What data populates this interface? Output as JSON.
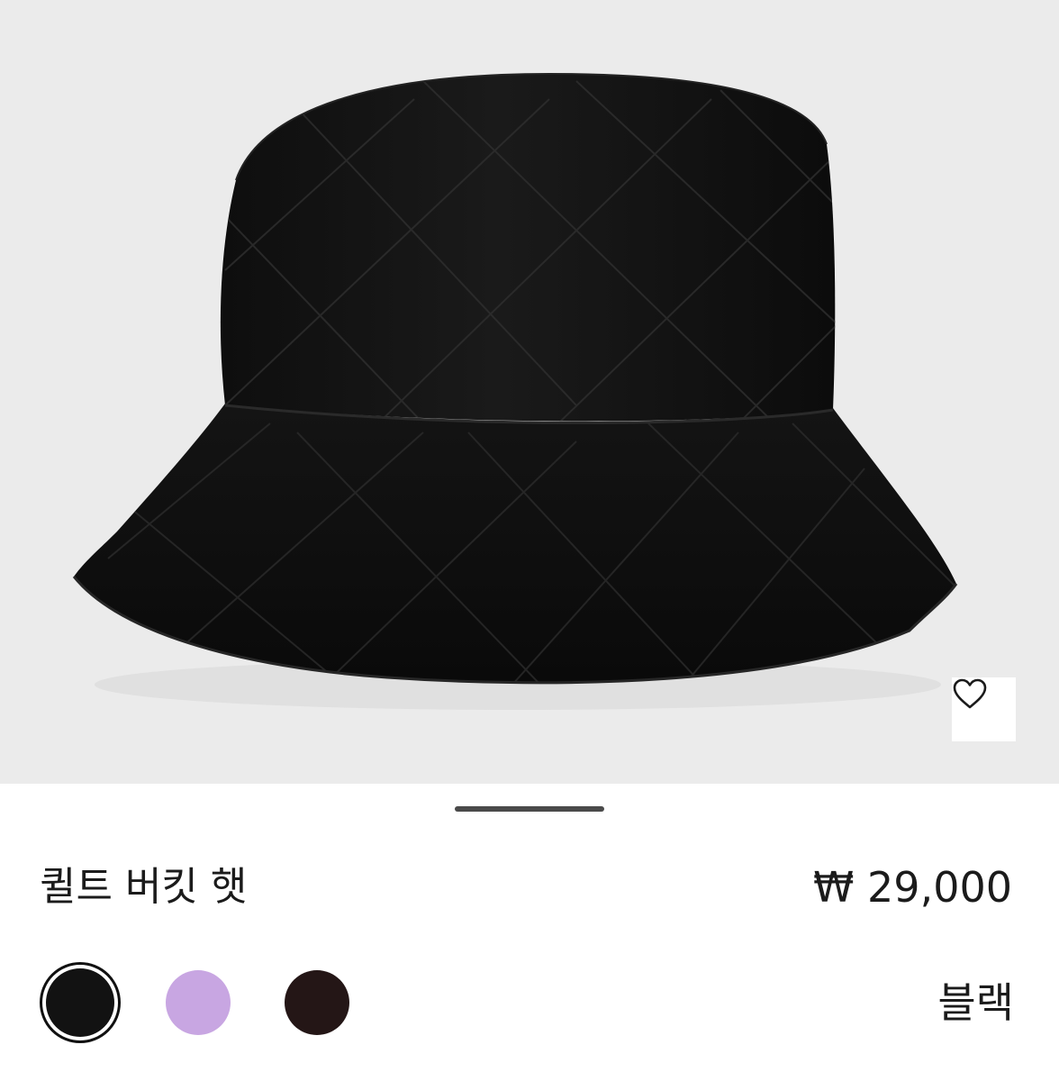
{
  "product": {
    "name": "퀼트 버킷 햇",
    "price": "₩ 29,000",
    "image_alt": "퀼트 버킷 햇"
  },
  "colors": {
    "selected_label": "블랙",
    "swatches": [
      {
        "name": "블랙",
        "hex": "#121212",
        "selected": true
      },
      {
        "name": "라벤더",
        "hex": "#c8a6e2",
        "selected": false
      },
      {
        "name": "브라운",
        "hex": "#241616",
        "selected": false
      }
    ]
  },
  "icons": {
    "wishlist": "heart-outline-icon"
  },
  "theme": {
    "image_background": "#ebebeb",
    "text": "#1b1b1b"
  }
}
